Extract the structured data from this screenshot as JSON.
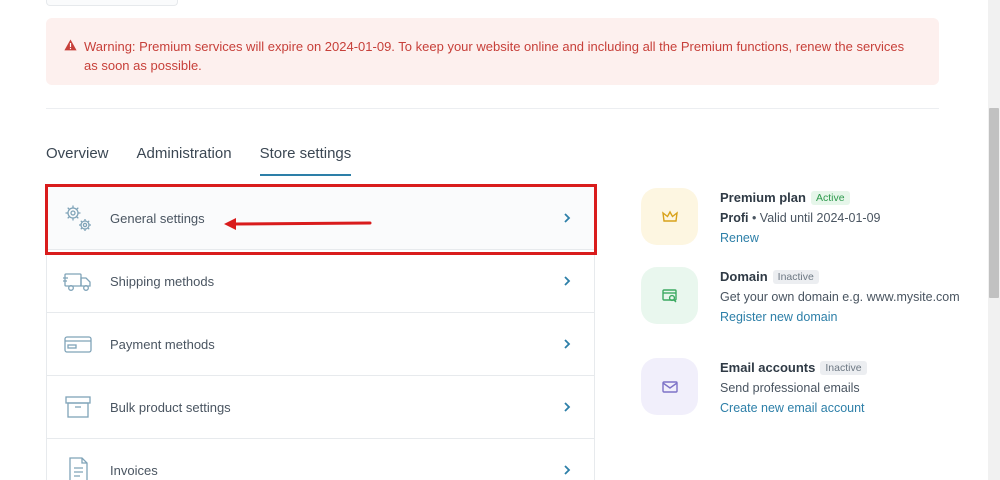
{
  "warning": {
    "text": "Warning: Premium services will expire on 2024-01-09. To keep your website online and including all the Premium functions, renew the services as soon as possible."
  },
  "tabs": [
    {
      "label": "Overview",
      "active": false
    },
    {
      "label": "Administration",
      "active": false
    },
    {
      "label": "Store settings",
      "active": true
    }
  ],
  "settings_list": [
    {
      "label": "General settings",
      "icon": "gears-icon"
    },
    {
      "label": "Shipping methods",
      "icon": "truck-icon"
    },
    {
      "label": "Payment methods",
      "icon": "card-icon"
    },
    {
      "label": "Bulk product settings",
      "icon": "box-icon"
    },
    {
      "label": "Invoices",
      "icon": "invoice-icon"
    }
  ],
  "cards": {
    "premium": {
      "title": "Premium plan",
      "badge": "Active",
      "plan_name": "Profi",
      "validity": " • Valid until 2024-01-09",
      "link": "Renew",
      "icon": "crown-icon"
    },
    "domain": {
      "title": "Domain",
      "badge": "Inactive",
      "desc": "Get your own domain e.g. www.mysite.com",
      "link": "Register new domain",
      "icon": "domain-search-icon"
    },
    "email": {
      "title": "Email accounts",
      "badge": "Inactive",
      "desc": "Send professional emails",
      "link": "Create new email account",
      "icon": "envelope-icon"
    }
  },
  "colors": {
    "accent": "#2d7fa8",
    "warning_text": "#c7403a",
    "warning_bg": "#fdf0ee",
    "highlight": "#d91c1c",
    "active_badge": "#2e9a4d"
  }
}
